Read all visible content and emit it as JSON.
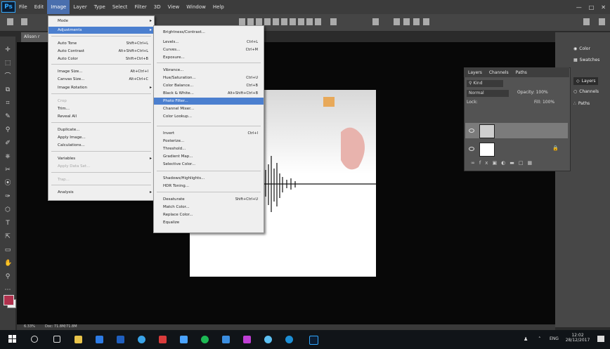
{
  "menubar": {
    "logo": "Ps",
    "items": [
      "File",
      "Edit",
      "Image",
      "Layer",
      "Type",
      "Select",
      "Filter",
      "3D",
      "View",
      "Window",
      "Help"
    ]
  },
  "doc_tab": {
    "label": "Alison r"
  },
  "image_menu": {
    "items": [
      {
        "label": "Mode",
        "shortcut": "",
        "submenu": true,
        "disabled": false
      },
      {
        "label": "Adjustments",
        "shortcut": "",
        "submenu": true,
        "disabled": false,
        "highlighted": true
      },
      {
        "label": "Auto Tone",
        "shortcut": "Shift+Ctrl+L",
        "submenu": false,
        "disabled": false
      },
      {
        "label": "Auto Contrast",
        "shortcut": "Alt+Shift+Ctrl+L",
        "submenu": false,
        "disabled": false
      },
      {
        "label": "Auto Color",
        "shortcut": "Shift+Ctrl+B",
        "submenu": false,
        "disabled": false
      },
      {
        "label": "Image Size...",
        "shortcut": "Alt+Ctrl+I",
        "submenu": false,
        "disabled": false
      },
      {
        "label": "Canvas Size...",
        "shortcut": "Alt+Ctrl+C",
        "submenu": false,
        "disabled": false
      },
      {
        "label": "Image Rotation",
        "shortcut": "",
        "submenu": true,
        "disabled": false
      },
      {
        "label": "Crop",
        "shortcut": "",
        "submenu": false,
        "disabled": true
      },
      {
        "label": "Trim...",
        "shortcut": "",
        "submenu": false,
        "disabled": false
      },
      {
        "label": "Reveal All",
        "shortcut": "",
        "submenu": false,
        "disabled": false
      },
      {
        "label": "Duplicate...",
        "shortcut": "",
        "submenu": false,
        "disabled": false
      },
      {
        "label": "Apply Image...",
        "shortcut": "",
        "submenu": false,
        "disabled": false
      },
      {
        "label": "Calculations...",
        "shortcut": "",
        "submenu": false,
        "disabled": false
      },
      {
        "label": "Variables",
        "shortcut": "",
        "submenu": true,
        "disabled": false
      },
      {
        "label": "Apply Data Set...",
        "shortcut": "",
        "submenu": false,
        "disabled": true
      },
      {
        "label": "Trap...",
        "shortcut": "",
        "submenu": false,
        "disabled": true
      },
      {
        "label": "Analysis",
        "shortcut": "",
        "submenu": true,
        "disabled": false
      }
    ]
  },
  "adj_menu": {
    "items": [
      {
        "label": "Brightness/Contrast...",
        "shortcut": ""
      },
      {
        "label": "Levels...",
        "shortcut": "Ctrl+L"
      },
      {
        "label": "Curves...",
        "shortcut": "Ctrl+M"
      },
      {
        "label": "Exposure...",
        "shortcut": ""
      },
      {
        "label": "Vibrance...",
        "shortcut": ""
      },
      {
        "label": "Hue/Saturation...",
        "shortcut": "Ctrl+U"
      },
      {
        "label": "Color Balance...",
        "shortcut": "Ctrl+B"
      },
      {
        "label": "Black & White...",
        "shortcut": "Alt+Shift+Ctrl+B"
      },
      {
        "label": "Photo Filter...",
        "shortcut": "",
        "highlighted": true
      },
      {
        "label": "Channel Mixer...",
        "shortcut": ""
      },
      {
        "label": "Color Lookup...",
        "shortcut": ""
      },
      {
        "label": "Invert",
        "shortcut": "Ctrl+I"
      },
      {
        "label": "Posterize...",
        "shortcut": ""
      },
      {
        "label": "Threshold...",
        "shortcut": ""
      },
      {
        "label": "Gradient Map...",
        "shortcut": ""
      },
      {
        "label": "Selective Color...",
        "shortcut": ""
      },
      {
        "label": "Shadows/Highlights...",
        "shortcut": ""
      },
      {
        "label": "HDR Toning...",
        "shortcut": ""
      },
      {
        "label": "Desaturate",
        "shortcut": "Shift+Ctrl+U"
      },
      {
        "label": "Match Color...",
        "shortcut": ""
      },
      {
        "label": "Replace Color...",
        "shortcut": ""
      },
      {
        "label": "Equalize",
        "shortcut": ""
      }
    ]
  },
  "layers_panel": {
    "tabs": [
      "Layers",
      "Channels",
      "Paths"
    ],
    "kind_label": "Kind",
    "blend_mode": "Normal",
    "opacity_label": "Opacity:",
    "opacity_value": "100%",
    "lock_label": "Lock:",
    "fill_label": "Fill:",
    "fill_value": "100%"
  },
  "right_dock": {
    "top": [
      "Color",
      "Swatches"
    ],
    "bottom": [
      "Layers",
      "Channels",
      "Paths"
    ]
  },
  "statusbar": {
    "zoom": "6.33%",
    "doc": "Doc: 71.8M/71.8M"
  },
  "taskbar": {
    "lang": "ENG",
    "time": "12:02",
    "date": "28/12/2017"
  }
}
